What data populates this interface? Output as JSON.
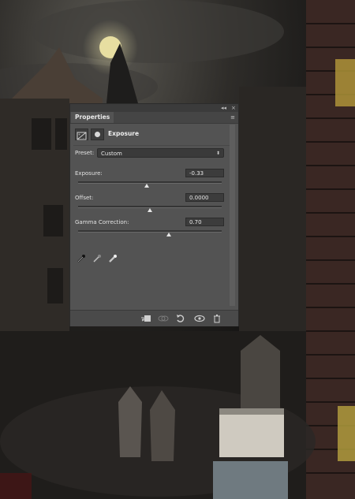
{
  "panel": {
    "tab_label": "Properties",
    "collapse_glyph": "◂◂",
    "close_glyph": "×",
    "menu_glyph": "≡",
    "header_title": "Exposure",
    "preset_label": "Preset:",
    "preset_value": "Custom",
    "exposure_label": "Exposure:",
    "exposure_value": "-0.33",
    "exposure_slider": 0.48,
    "offset_label": "Offset:",
    "offset_value": "0.0000",
    "offset_slider": 0.5,
    "gamma_label": "Gamma Correction:",
    "gamma_value": "0.70",
    "gamma_slider": 0.63,
    "icons": [
      "adjustment-layer-icon",
      "layer-mask-icon",
      "black-point-eyedropper-icon",
      "gray-point-eyedropper-icon",
      "white-point-eyedropper-icon",
      "clip-to-layer-icon",
      "view-previous-state-icon",
      "reset-icon",
      "visibility-eye-icon",
      "delete-icon"
    ]
  },
  "colors": {
    "panel_bg": "#535353",
    "titlebar_bg": "#3b3b3b",
    "moon": "#e7dea1"
  }
}
